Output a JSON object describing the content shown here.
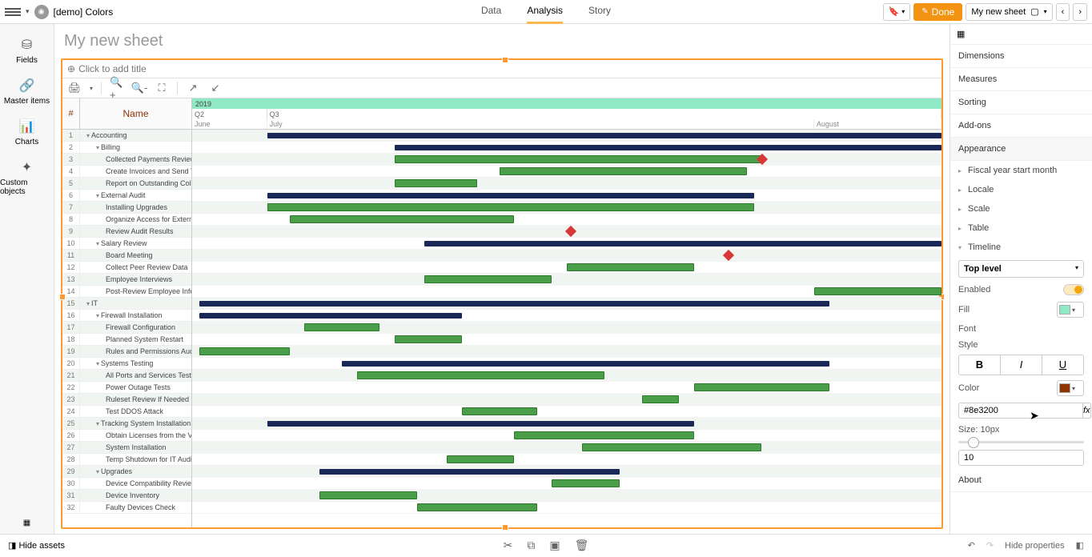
{
  "topbar": {
    "title": "[demo] Colors",
    "tabs": [
      "Data",
      "Analysis",
      "Story"
    ],
    "activeTab": 1,
    "done": "Done",
    "sheetBtn": "My new sheet"
  },
  "rail": [
    {
      "icon": "⛁",
      "label": "Fields"
    },
    {
      "icon": "🔗",
      "label": "Master items"
    },
    {
      "icon": "📊",
      "label": "Charts"
    },
    {
      "icon": "✦",
      "label": "Custom objects"
    }
  ],
  "sheetTitle": "My new sheet",
  "vizTitle": "Click to add title",
  "ganttHeader": {
    "hash": "#",
    "name": "Name",
    "year": "2019",
    "quarters": [
      {
        "label": "Q2",
        "w": 10
      },
      {
        "label": "Q3",
        "w": 90
      }
    ],
    "months": [
      {
        "label": "June",
        "w": 10
      },
      {
        "label": "July",
        "w": 73
      },
      {
        "label": "August",
        "w": 17
      }
    ]
  },
  "rows": [
    {
      "n": 1,
      "name": "Accounting",
      "ind": 0,
      "tog": "▾",
      "bar": {
        "t": "sum",
        "l": 10,
        "w": 90
      }
    },
    {
      "n": 2,
      "name": "Billing",
      "ind": 1,
      "tog": "▾",
      "bar": {
        "t": "sum",
        "l": 27,
        "w": 73
      }
    },
    {
      "n": 3,
      "name": "Collected Payments Review",
      "ind": 2,
      "bar": {
        "t": "task",
        "l": 27,
        "w": 49
      },
      "ms": 75.5
    },
    {
      "n": 4,
      "name": "Create Invoices and Send Them",
      "ind": 2,
      "bar": {
        "t": "task",
        "l": 41,
        "w": 33
      }
    },
    {
      "n": 5,
      "name": "Report on Outstanding Coll",
      "ind": 2,
      "bar": {
        "t": "task",
        "l": 27,
        "w": 11
      }
    },
    {
      "n": 6,
      "name": "External Audit",
      "ind": 1,
      "tog": "▾",
      "bar": {
        "t": "sum",
        "l": 10,
        "w": 65
      }
    },
    {
      "n": 7,
      "name": "Installing Upgrades",
      "ind": 2,
      "bar": {
        "t": "task",
        "l": 10,
        "w": 65
      }
    },
    {
      "n": 8,
      "name": "Organize Access for External",
      "ind": 2,
      "bar": {
        "t": "task",
        "l": 13,
        "w": 30
      }
    },
    {
      "n": 9,
      "name": "Review Audit Results",
      "ind": 2,
      "ms": 50
    },
    {
      "n": 10,
      "name": "Salary Review",
      "ind": 1,
      "tog": "▾",
      "bar": {
        "t": "sum",
        "l": 31,
        "w": 69
      }
    },
    {
      "n": 11,
      "name": "Board Meeting",
      "ind": 2,
      "ms": 71
    },
    {
      "n": 12,
      "name": "Collect Peer Review Data",
      "ind": 2,
      "bar": {
        "t": "task",
        "l": 50,
        "w": 17
      }
    },
    {
      "n": 13,
      "name": "Employee Interviews",
      "ind": 2,
      "bar": {
        "t": "task",
        "l": 31,
        "w": 17
      }
    },
    {
      "n": 14,
      "name": "Post-Review Employee Info",
      "ind": 2,
      "bar": {
        "t": "task",
        "l": 83,
        "w": 17
      }
    },
    {
      "n": 15,
      "name": "IT",
      "ind": 0,
      "tog": "▾",
      "bar": {
        "t": "sum",
        "l": 1,
        "w": 84
      }
    },
    {
      "n": 16,
      "name": "Firewall Installation",
      "ind": 1,
      "tog": "▾",
      "bar": {
        "t": "sum",
        "l": 1,
        "w": 35
      }
    },
    {
      "n": 17,
      "name": "Firewall Configuration",
      "ind": 2,
      "bar": {
        "t": "task",
        "l": 15,
        "w": 10
      }
    },
    {
      "n": 18,
      "name": "Planned System Restart",
      "ind": 2,
      "bar": {
        "t": "task",
        "l": 27,
        "w": 9
      }
    },
    {
      "n": 19,
      "name": "Rules and Permissions Audit",
      "ind": 2,
      "bar": {
        "t": "task",
        "l": 1,
        "w": 12
      }
    },
    {
      "n": 20,
      "name": "Systems Testing",
      "ind": 1,
      "tog": "▾",
      "bar": {
        "t": "sum",
        "l": 20,
        "w": 65
      }
    },
    {
      "n": 21,
      "name": "All Ports and Services Test",
      "ind": 2,
      "bar": {
        "t": "task",
        "l": 22,
        "w": 33
      }
    },
    {
      "n": 22,
      "name": "Power Outage Tests",
      "ind": 2,
      "bar": {
        "t": "task",
        "l": 67,
        "w": 18
      }
    },
    {
      "n": 23,
      "name": "Ruleset Review If Needed",
      "ind": 2,
      "bar": {
        "t": "task",
        "l": 60,
        "w": 5
      }
    },
    {
      "n": 24,
      "name": "Test DDOS Attack",
      "ind": 2,
      "bar": {
        "t": "task",
        "l": 36,
        "w": 10
      }
    },
    {
      "n": 25,
      "name": "Tracking System Installation",
      "ind": 1,
      "tog": "▾",
      "bar": {
        "t": "sum",
        "l": 10,
        "w": 57
      }
    },
    {
      "n": 26,
      "name": "Obtain Licenses from the Vendor",
      "ind": 2,
      "bar": {
        "t": "task",
        "l": 43,
        "w": 24
      }
    },
    {
      "n": 27,
      "name": "System Installation",
      "ind": 2,
      "bar": {
        "t": "task",
        "l": 52,
        "w": 24
      }
    },
    {
      "n": 28,
      "name": "Temp Shutdown for IT Audit",
      "ind": 2,
      "bar": {
        "t": "task",
        "l": 34,
        "w": 9
      }
    },
    {
      "n": 29,
      "name": "Upgrades",
      "ind": 1,
      "tog": "▾",
      "bar": {
        "t": "sum",
        "l": 17,
        "w": 40
      }
    },
    {
      "n": 30,
      "name": "Device Compatibility Review",
      "ind": 2,
      "bar": {
        "t": "task",
        "l": 48,
        "w": 9
      }
    },
    {
      "n": 31,
      "name": "Device Inventory",
      "ind": 2,
      "bar": {
        "t": "task",
        "l": 17,
        "w": 13
      }
    },
    {
      "n": 32,
      "name": "Faulty Devices Check",
      "ind": 2,
      "bar": {
        "t": "task",
        "l": 30,
        "w": 16
      }
    }
  ],
  "props": {
    "sections": [
      "Dimensions",
      "Measures",
      "Sorting",
      "Add-ons",
      "Appearance"
    ],
    "appearance": [
      "Fiscal year start month",
      "Locale",
      "Scale",
      "Table",
      "Timeline"
    ],
    "timeline": {
      "levelDd": "Top level",
      "enabled": "Enabled",
      "fill": "Fill",
      "fillColor": "#8fe9c4",
      "font": "Font",
      "style": "Style",
      "color": "Color",
      "colorVal": "#8e3200",
      "colorSwatch": "#8e3200",
      "size": "Size: 10px",
      "sizeVal": "10"
    },
    "about": "About"
  },
  "bottom": {
    "assets": "Hide assets",
    "props": "Hide properties"
  }
}
